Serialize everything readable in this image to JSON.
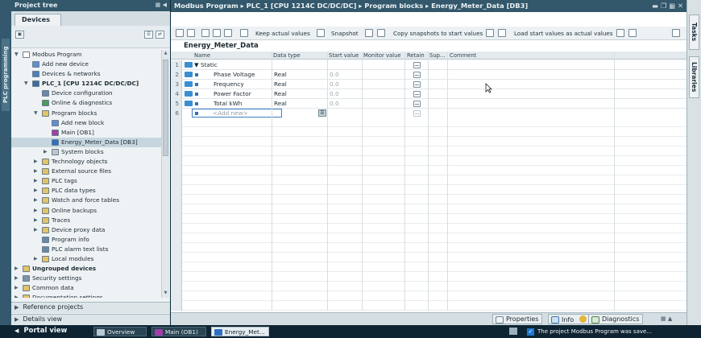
{
  "sidebar_left": {
    "label": "PLC programming"
  },
  "project_tree": {
    "title": "Project tree",
    "devices_tab": "Devices",
    "items": [
      {
        "label": "Modbus Program",
        "level": 0,
        "expander": "open",
        "icon": "project-icon",
        "color": "#ffffff"
      },
      {
        "label": "Add new device",
        "level": 1,
        "expander": "none",
        "icon": "add-device-icon",
        "color": "#5f8fcf"
      },
      {
        "label": "Devices & networks",
        "level": 1,
        "expander": "none",
        "icon": "network-icon",
        "color": "#4d7fb8"
      },
      {
        "label": "PLC_1 [CPU 1214C DC/DC/DC]",
        "level": 1,
        "expander": "open",
        "icon": "plc-icon",
        "color": "#3b6e9e",
        "bold": true
      },
      {
        "label": "Device configuration",
        "level": 2,
        "expander": "none",
        "icon": "device-config-icon",
        "color": "#6b87a8"
      },
      {
        "label": "Online & diagnostics",
        "level": 2,
        "expander": "none",
        "icon": "diagnostics-icon",
        "color": "#4b9a57"
      },
      {
        "label": "Program blocks",
        "level": 2,
        "expander": "open",
        "icon": "folder-icon",
        "color": "#e3c365"
      },
      {
        "label": "Add new block",
        "level": 3,
        "expander": "none",
        "icon": "add-block-icon",
        "color": "#5f8fcf"
      },
      {
        "label": "Main [OB1]",
        "level": 3,
        "expander": "none",
        "icon": "ob-icon",
        "color": "#a13ea8"
      },
      {
        "label": "Energy_Meter_Data [DB3]",
        "level": 3,
        "expander": "none",
        "icon": "db-icon",
        "color": "#2f6fc2",
        "selected": true
      },
      {
        "label": "System blocks",
        "level": 3,
        "expander": "closed",
        "icon": "folder-icon",
        "color": "#bfc6cc"
      },
      {
        "label": "Technology objects",
        "level": 2,
        "expander": "closed",
        "icon": "folder-icon",
        "color": "#e3c365"
      },
      {
        "label": "External source files",
        "level": 2,
        "expander": "closed",
        "icon": "folder-icon",
        "color": "#e3c365"
      },
      {
        "label": "PLC tags",
        "level": 2,
        "expander": "closed",
        "icon": "folder-icon",
        "color": "#e3c365"
      },
      {
        "label": "PLC data types",
        "level": 2,
        "expander": "closed",
        "icon": "folder-icon",
        "color": "#e3c365"
      },
      {
        "label": "Watch and force tables",
        "level": 2,
        "expander": "closed",
        "icon": "folder-icon",
        "color": "#e3c365"
      },
      {
        "label": "Online backups",
        "level": 2,
        "expander": "closed",
        "icon": "folder-icon",
        "color": "#e3c365"
      },
      {
        "label": "Traces",
        "level": 2,
        "expander": "closed",
        "icon": "folder-icon",
        "color": "#e3c365"
      },
      {
        "label": "Device proxy data",
        "level": 2,
        "expander": "closed",
        "icon": "folder-icon",
        "color": "#e3c365"
      },
      {
        "label": "Program info",
        "level": 2,
        "expander": "none",
        "icon": "program-info-icon",
        "color": "#6b87a8"
      },
      {
        "label": "PLC alarm text lists",
        "level": 2,
        "expander": "none",
        "icon": "alarm-text-icon",
        "color": "#6b87a8"
      },
      {
        "label": "Local modules",
        "level": 2,
        "expander": "closed",
        "icon": "folder-icon",
        "color": "#e3c365"
      },
      {
        "label": "Ungrouped devices",
        "level": 0,
        "expander": "closed",
        "icon": "folder-icon",
        "color": "#e3c365",
        "bold": true
      },
      {
        "label": "Security settings",
        "level": 0,
        "expander": "closed",
        "icon": "security-icon",
        "color": "#7e93a8"
      },
      {
        "label": "Common data",
        "level": 0,
        "expander": "closed",
        "icon": "folder-icon",
        "color": "#e3c365"
      },
      {
        "label": "Documentation settings",
        "level": 0,
        "expander": "closed",
        "icon": "folder-icon",
        "color": "#e3c365"
      }
    ],
    "reference_projects": "Reference projects",
    "details_view": "Details view"
  },
  "editor": {
    "breadcrumb": "Modbus Program ▸ PLC_1 [CPU 1214C DC/DC/DC] ▸ Program blocks ▸ Energy_Meter_Data [DB3]",
    "toolbar": {
      "keep_actual_values": "Keep actual values",
      "snapshot": "Snapshot",
      "copy_snapshots": "Copy snapshots to start values",
      "load_start_values": "Load start values as actual values"
    },
    "block_name": "Energy_Meter_Data",
    "columns": [
      "Name",
      "Data type",
      "Start value",
      "Monitor value",
      "Retain",
      "Sup...",
      "Comment"
    ],
    "rows": [
      {
        "num": "1",
        "name": "▼ Static",
        "type": "",
        "start": "",
        "kind": "header"
      },
      {
        "num": "2",
        "name": "Phase Voltage",
        "type": "Real",
        "start": "0.0"
      },
      {
        "num": "3",
        "name": "Frequency",
        "type": "Real",
        "start": "0.0"
      },
      {
        "num": "4",
        "name": "Power Factor",
        "type": "Real",
        "start": "0.0"
      },
      {
        "num": "5",
        "name": "Total kWh",
        "type": "Real",
        "start": "0.0"
      },
      {
        "num": "6",
        "name": "",
        "type": "",
        "start": "",
        "kind": "add"
      }
    ],
    "add_new_placeholder": "<Add new>"
  },
  "right_tabs": [
    "Tasks",
    "Libraries"
  ],
  "inspector": {
    "properties": "Properties",
    "info": "Info",
    "diagnostics": "Diagnostics"
  },
  "portal_bar": {
    "portal_view": "Portal view",
    "tasks": [
      {
        "label": "Overview",
        "icon": "overview-icon",
        "color": "#b9c9d2"
      },
      {
        "label": "Main (OB1)",
        "icon": "ob-icon",
        "color": "#a13ea8"
      },
      {
        "label": "Energy_Met...",
        "icon": "db-icon",
        "color": "#2f6fc2",
        "active": true
      }
    ],
    "status": "The project Modbus Program was save..."
  }
}
